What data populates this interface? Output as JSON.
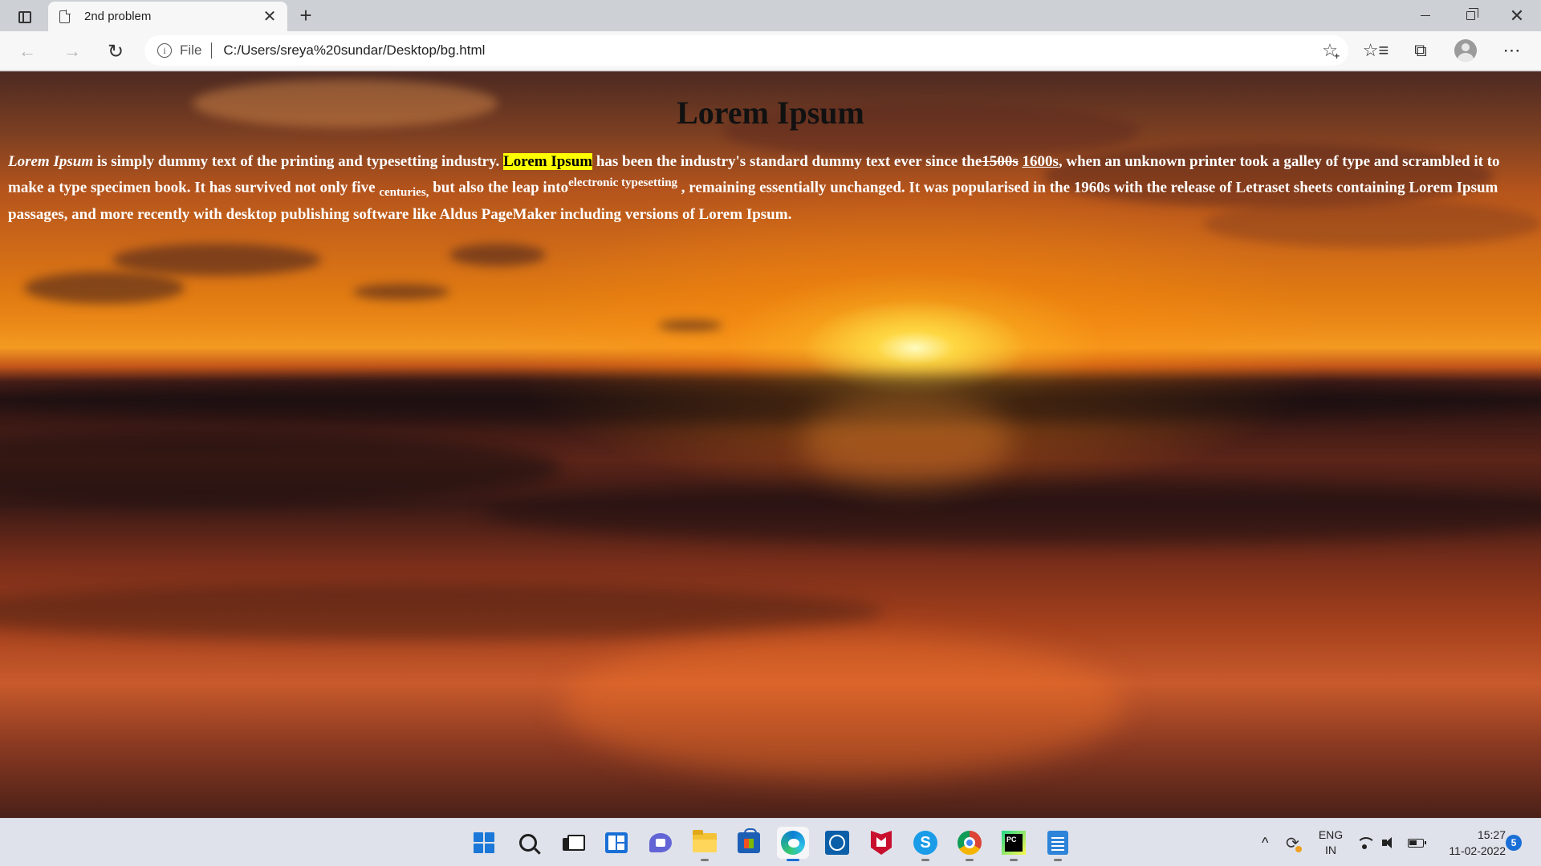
{
  "browser": {
    "tab_title": "2nd problem",
    "close_glyph": "✕",
    "newtab_glyph": "+",
    "address": {
      "scheme_label": "File",
      "url": "C:/Users/sreya%20sundar/Desktop/bg.html"
    },
    "icons": [
      "tab-actions-icon",
      "page-icon",
      "back-icon",
      "forward-icon",
      "reload-icon",
      "info-icon",
      "add-favorite-icon",
      "favorites-icon",
      "collections-icon",
      "profile-avatar",
      "more-icon",
      "minimize-icon",
      "maximize-icon",
      "close-icon"
    ]
  },
  "page": {
    "heading": "Lorem Ipsum",
    "para": {
      "p1_italic": "Lorem Ipsum",
      "p2": " is simply dummy text of the printing and typesetting industry. ",
      "p3_highlight": "Lorem Ipsum",
      "p4": " has been the industry's standard dummy text ever since the",
      "p5_deleted": "1500s",
      "p6": " ",
      "p7_inserted": "1600s",
      "p8": ", when an unknown printer took a galley of type and scrambled it to make a type specimen book. It has survived not only five ",
      "p9_sub": "centuries,",
      "p10": " but also the leap into",
      "p11_sup": "electronic typesetting",
      "p12": " , remaining essentially unchanged. It was popularised in the 1960s with the release of Letraset sheets containing Lorem Ipsum passages, and more recently with desktop publishing software like Aldus PageMaker including versions of Lorem Ipsum."
    },
    "colors": {
      "highlight": "#ffff00",
      "text": "#ffffff",
      "heading": "#111111"
    }
  },
  "taskbar": {
    "apps": [
      "start-icon",
      "search-icon",
      "task-view-icon",
      "widgets-icon",
      "chat-icon",
      "file-explorer-icon",
      "store-icon",
      "edge-icon",
      "dell-icon",
      "mcafee-icon",
      "skype-icon",
      "chrome-icon",
      "pycharm-icon",
      "notepad-icon"
    ],
    "skype_letter": "S",
    "pycharm_label": "PC",
    "tray": {
      "chevron": "^",
      "lang_line1": "ENG",
      "lang_line2": "IN",
      "time": "15:27",
      "date": "11-02-2022",
      "notification_count": "5"
    }
  }
}
